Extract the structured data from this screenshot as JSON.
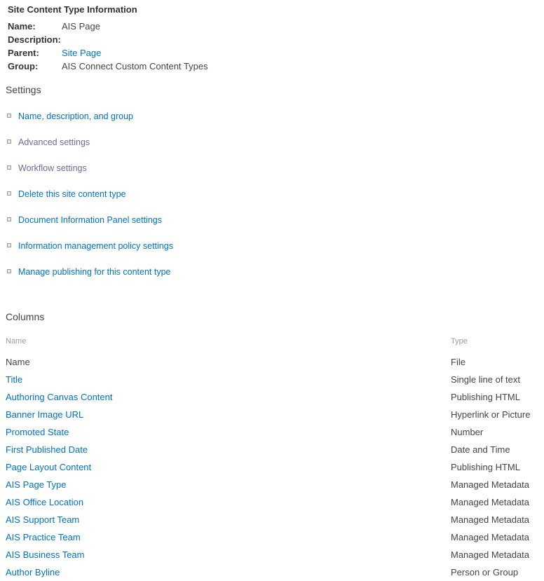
{
  "info": {
    "title": "Site Content Type Information",
    "rows": [
      {
        "label": "Name:",
        "value": "AIS Page",
        "is_link": false
      },
      {
        "label": "Description:",
        "value": "",
        "is_link": false
      },
      {
        "label": "Parent:",
        "value": "Site Page",
        "is_link": true
      },
      {
        "label": "Group:",
        "value": "AIS Connect Custom Content Types",
        "is_link": false
      }
    ]
  },
  "settings": {
    "heading": "Settings",
    "bullet_icon": "square-bullet-icon",
    "items": [
      {
        "label": "Name, description, and group",
        "state": "normal"
      },
      {
        "label": "Advanced settings",
        "state": "visited"
      },
      {
        "label": "Workflow settings",
        "state": "visited"
      },
      {
        "label": "Delete this site content type",
        "state": "normal"
      },
      {
        "label": "Document Information Panel settings",
        "state": "normal"
      },
      {
        "label": "Information management policy settings",
        "state": "normal"
      },
      {
        "label": "Manage publishing for this content type",
        "state": "normal"
      }
    ]
  },
  "columns": {
    "heading": "Columns",
    "headers": {
      "name": "Name",
      "type": "Type"
    },
    "rows": [
      {
        "name": "Name",
        "type": "File",
        "is_link": false
      },
      {
        "name": "Title",
        "type": "Single line of text",
        "is_link": true
      },
      {
        "name": "Authoring Canvas Content",
        "type": "Publishing HTML",
        "is_link": true
      },
      {
        "name": "Banner Image URL",
        "type": "Hyperlink or Picture",
        "is_link": true
      },
      {
        "name": "Promoted State",
        "type": "Number",
        "is_link": true
      },
      {
        "name": "First Published Date",
        "type": "Date and Time",
        "is_link": true
      },
      {
        "name": "Page Layout Content",
        "type": "Publishing HTML",
        "is_link": true
      },
      {
        "name": "AIS Page Type",
        "type": "Managed Metadata",
        "is_link": true
      },
      {
        "name": "AIS Office Location",
        "type": "Managed Metadata",
        "is_link": true
      },
      {
        "name": "AIS Support Team",
        "type": "Managed Metadata",
        "is_link": true
      },
      {
        "name": "AIS Practice Team",
        "type": "Managed Metadata",
        "is_link": true
      },
      {
        "name": "AIS Business Team",
        "type": "Managed Metadata",
        "is_link": true
      },
      {
        "name": "Author Byline",
        "type": "Person or Group",
        "is_link": true
      }
    ]
  },
  "theme": {
    "link_color": "#0072c6",
    "visited_link_color": "#6b6b9a",
    "text_color": "#444444",
    "muted_color": "#9a9a9a",
    "background": "#ffffff"
  }
}
